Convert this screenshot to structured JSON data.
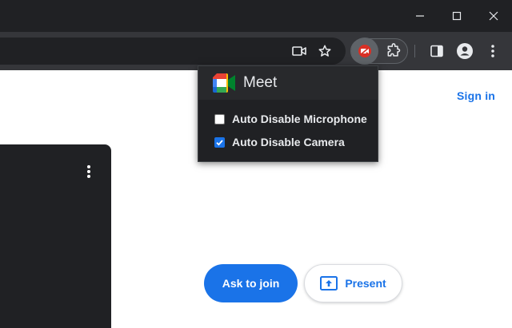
{
  "window": {
    "controls": [
      "minimize",
      "maximize",
      "close"
    ]
  },
  "toolbar": {
    "icons": [
      "camera-icon",
      "star-icon",
      "meet-extension-icon",
      "puzzle-icon",
      "side-panel-icon",
      "profile-icon",
      "kebab-menu-icon"
    ]
  },
  "popup": {
    "title": "Meet",
    "options": [
      {
        "label": "Auto Disable Microphone",
        "checked": false
      },
      {
        "label": "Auto Disable Camera",
        "checked": true
      }
    ]
  },
  "page": {
    "sign_in": "Sign in",
    "ask_to_join": "Ask to join",
    "present": "Present"
  },
  "colors": {
    "accent": "#1a73e8",
    "titlebar": "#202124",
    "toolbar": "#35363a",
    "extension_badge": "#d93025"
  }
}
